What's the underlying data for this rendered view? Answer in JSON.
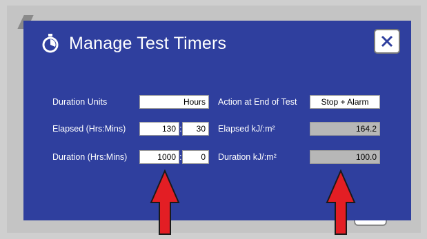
{
  "dialog": {
    "title": "Manage Test Timers",
    "close_label": "✕"
  },
  "rows": {
    "duration_units": {
      "label": "Duration Units",
      "value": "Hours"
    },
    "elapsed": {
      "label": "Elapsed (Hrs:Mins)",
      "hours": "130",
      "separator": ":",
      "minutes": "30"
    },
    "duration": {
      "label": "Duration (Hrs:Mins)",
      "hours": "1000",
      "separator": ":",
      "minutes": "0"
    },
    "action_end": {
      "label": "Action at End of Test",
      "value": "Stop + Alarm"
    },
    "elapsed_kj": {
      "label": "Elapsed kJ/:m²",
      "value": "164.2"
    },
    "duration_kj": {
      "label": "Duration kJ/:m²",
      "value": "100.0"
    }
  },
  "icons": {
    "title_icon": "stopwatch-icon",
    "close_icon": "close-icon",
    "annotation": "red-arrow"
  },
  "colors": {
    "dialog_bg": "#2f3f9e",
    "arrow": "#e31e24",
    "readonly_field": "#b7b7b7"
  }
}
